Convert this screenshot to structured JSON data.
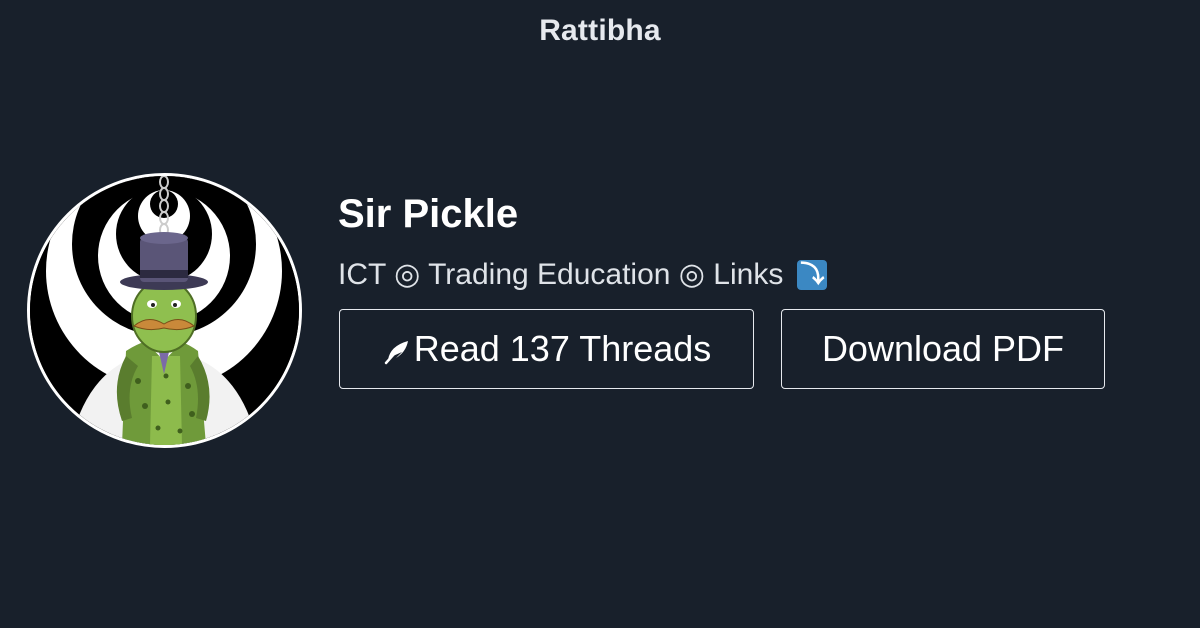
{
  "site": {
    "brand": "Rattibha"
  },
  "profile": {
    "name": "Sir Pickle",
    "bio_text": "ICT ◎ Trading Education ◎ Links",
    "bio_emoji": "⤵",
    "avatar_icon": "pickle-gentleman-avatar"
  },
  "actions": {
    "read_label": "Read 137 Threads",
    "read_icon": "feather-icon",
    "download_label": "Download PDF"
  },
  "colors": {
    "background": "#18202b",
    "text": "#ffffff",
    "button_border": "#e6e9ee",
    "emoji_bg": "#3b88c3"
  }
}
